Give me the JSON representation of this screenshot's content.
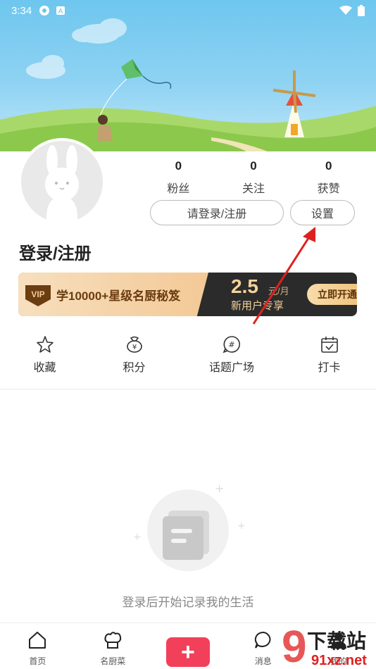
{
  "status_bar": {
    "time": "3:34"
  },
  "profile": {
    "stats": [
      {
        "value": "0",
        "label": "粉丝"
      },
      {
        "value": "0",
        "label": "关注"
      },
      {
        "value": "0",
        "label": "获赞"
      }
    ],
    "login_button": "请登录/注册",
    "settings_button": "设置",
    "title": "登录/注册"
  },
  "vip": {
    "badge": "VIP",
    "title": "学10000+星级名厨秘笈",
    "price": "2.5",
    "unit": "元/月",
    "subtitle": "新用户专享",
    "cta": "立即开通"
  },
  "quick_actions": [
    {
      "label": "收藏",
      "icon": "star-icon"
    },
    {
      "label": "积分",
      "icon": "points-bag-icon"
    },
    {
      "label": "话题广场",
      "icon": "hashtag-icon"
    },
    {
      "label": "打卡",
      "icon": "calendar-check-icon"
    }
  ],
  "empty_state": {
    "text": "登录后开始记录我的生活"
  },
  "bottom_nav": [
    {
      "label": "首页",
      "icon": "home-icon"
    },
    {
      "label": "名厨菜",
      "icon": "chef-hat-icon"
    },
    {
      "label": "",
      "icon": "plus-icon"
    },
    {
      "label": "消息",
      "icon": "message-icon"
    },
    {
      "label": "我的",
      "icon": "profile-icon"
    }
  ],
  "watermark": {
    "line1": "下载站",
    "line2": "91xz.net",
    "mark": "9"
  },
  "colors": {
    "accent": "#f2405a",
    "vip_dark": "#2b2b2b",
    "vip_gold": "#f3d39b",
    "annotation": "#e02020"
  }
}
